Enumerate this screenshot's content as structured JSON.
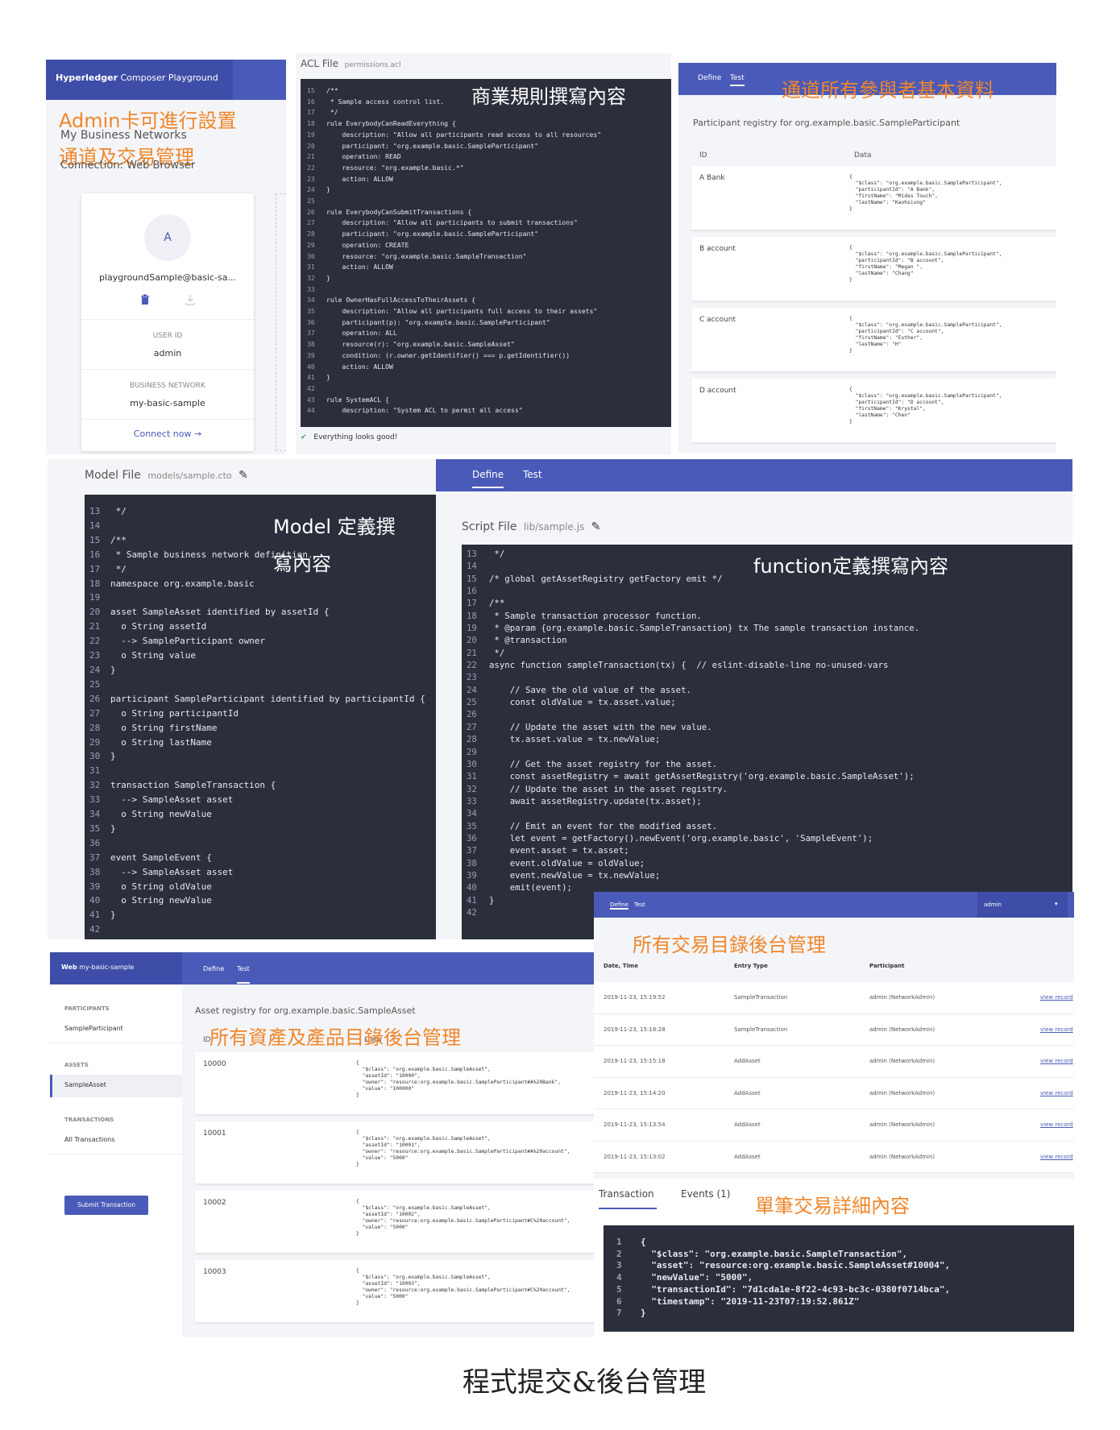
{
  "admin_panel": {
    "header": "Hyperledger Composer Playground",
    "header_bold": "Hyperledger",
    "header_rest": "Composer Playground",
    "networks_label": "My Business Networks",
    "connection_label": "Connection: Web Browser",
    "annotation_1": "Admin卡可進行設置",
    "annotation_2": "通道及交易管理",
    "card": {
      "avatar_letter": "A",
      "name": "playgroundSample@basic-sa...",
      "user_id_label": "USER ID",
      "user_id": "admin",
      "network_label": "BUSINESS NETWORK",
      "network": "my-basic-sample",
      "connect_label": "Connect now →"
    }
  },
  "acl_panel": {
    "title": "ACL File",
    "filename": "permissions.acl",
    "annotation": "商業規則撰寫內容",
    "status": "Everything looks good!",
    "lines": [
      {
        "n": "15",
        "t": "/**"
      },
      {
        "n": "16",
        "t": " * Sample access control list."
      },
      {
        "n": "17",
        "t": " */"
      },
      {
        "n": "18",
        "t": "rule EverybodyCanReadEverything {"
      },
      {
        "n": "19",
        "t": "    description: \"Allow all participants read access to all resources\""
      },
      {
        "n": "20",
        "t": "    participant: \"org.example.basic.SampleParticipant\""
      },
      {
        "n": "21",
        "t": "    operation: READ"
      },
      {
        "n": "22",
        "t": "    resource: \"org.example.basic.*\""
      },
      {
        "n": "23",
        "t": "    action: ALLOW"
      },
      {
        "n": "24",
        "t": "}"
      },
      {
        "n": "25",
        "t": ""
      },
      {
        "n": "26",
        "t": "rule EverybodyCanSubmitTransactions {"
      },
      {
        "n": "27",
        "t": "    description: \"Allow all participants to submit transactions\""
      },
      {
        "n": "28",
        "t": "    participant: \"org.example.basic.SampleParticipant\""
      },
      {
        "n": "29",
        "t": "    operation: CREATE"
      },
      {
        "n": "30",
        "t": "    resource: \"org.example.basic.SampleTransaction\""
      },
      {
        "n": "31",
        "t": "    action: ALLOW"
      },
      {
        "n": "32",
        "t": "}"
      },
      {
        "n": "33",
        "t": ""
      },
      {
        "n": "34",
        "t": "rule OwnerHasFullAccessToTheirAssets {"
      },
      {
        "n": "35",
        "t": "    description: \"Allow all participants full access to their assets\""
      },
      {
        "n": "36",
        "t": "    participant(p): \"org.example.basic.SampleParticipant\""
      },
      {
        "n": "37",
        "t": "    operation: ALL"
      },
      {
        "n": "38",
        "t": "    resource(r): \"org.example.basic.SampleAsset\""
      },
      {
        "n": "39",
        "t": "    condition: (r.owner.getIdentifier() === p.getIdentifier())"
      },
      {
        "n": "40",
        "t": "    action: ALLOW"
      },
      {
        "n": "41",
        "t": "}"
      },
      {
        "n": "42",
        "t": ""
      },
      {
        "n": "43",
        "t": "rule SystemACL {"
      },
      {
        "n": "44",
        "t": "    description: \"System ACL to permit all access\""
      }
    ]
  },
  "participant_panel": {
    "tabs": [
      "Define",
      "Test"
    ],
    "annotation": "通道所有參與者基本資料",
    "registry_title": "Participant registry for org.example.basic.SampleParticipant",
    "col_id": "ID",
    "col_data": "Data",
    "records": [
      {
        "id": "A Bank",
        "data": "{\n  \"$class\": \"org.example.basic.SampleParticipant\",\n  \"participantId\": \"A Bank\",\n  \"firstName\": \"Midas Touch\",\n  \"lastName\": \"Kaohsiung\"\n}"
      },
      {
        "id": "B account",
        "data": "{\n  \"$class\": \"org.example.basic.SampleParticipant\",\n  \"participantId\": \"B account\",\n  \"firstName\": \"Megan \",\n  \"lastName\": \"Chang\"\n}"
      },
      {
        "id": "C account",
        "data": "{\n  \"$class\": \"org.example.basic.SampleParticipant\",\n  \"participantId\": \"C account\",\n  \"firstName\": \"Esther\",\n  \"lastName\": \"H\"\n}"
      },
      {
        "id": "D account",
        "data": "{\n  \"$class\": \"org.example.basic.SampleParticipant\",\n  \"participantId\": \"D account\",\n  \"firstName\": \"Krystal\",\n  \"lastName\": \"Chen\"\n}"
      }
    ]
  },
  "model_panel": {
    "title": "Model File",
    "filename": "models/sample.cto",
    "annotation_1": "Model 定義撰",
    "annotation_2": "寫內容",
    "lines": [
      {
        "n": "13",
        "t": " */"
      },
      {
        "n": "14",
        "t": ""
      },
      {
        "n": "15",
        "t": "/**"
      },
      {
        "n": "16",
        "t": " * Sample business network definition."
      },
      {
        "n": "17",
        "t": " */"
      },
      {
        "n": "18",
        "t": "namespace org.example.basic"
      },
      {
        "n": "19",
        "t": ""
      },
      {
        "n": "20",
        "t": "asset SampleAsset identified by assetId {"
      },
      {
        "n": "21",
        "t": "  o String assetId"
      },
      {
        "n": "22",
        "t": "  --> SampleParticipant owner"
      },
      {
        "n": "23",
        "t": "  o String value"
      },
      {
        "n": "24",
        "t": "}"
      },
      {
        "n": "25",
        "t": ""
      },
      {
        "n": "26",
        "t": "participant SampleParticipant identified by participantId {"
      },
      {
        "n": "27",
        "t": "  o String participantId"
      },
      {
        "n": "28",
        "t": "  o String firstName"
      },
      {
        "n": "29",
        "t": "  o String lastName"
      },
      {
        "n": "30",
        "t": "}"
      },
      {
        "n": "31",
        "t": ""
      },
      {
        "n": "32",
        "t": "transaction SampleTransaction {"
      },
      {
        "n": "33",
        "t": "  --> SampleAsset asset"
      },
      {
        "n": "34",
        "t": "  o String newValue"
      },
      {
        "n": "35",
        "t": "}"
      },
      {
        "n": "36",
        "t": ""
      },
      {
        "n": "37",
        "t": "event SampleEvent {"
      },
      {
        "n": "38",
        "t": "  --> SampleAsset asset"
      },
      {
        "n": "39",
        "t": "  o String oldValue"
      },
      {
        "n": "40",
        "t": "  o String newValue"
      },
      {
        "n": "41",
        "t": "}"
      },
      {
        "n": "42",
        "t": ""
      }
    ]
  },
  "script_panel": {
    "tabs": [
      "Define",
      "Test"
    ],
    "title": "Script File",
    "filename": "lib/sample.js",
    "annotation": "function定義撰寫內容",
    "lines": [
      {
        "n": "13",
        "t": " */"
      },
      {
        "n": "14",
        "t": ""
      },
      {
        "n": "15",
        "t": "/* global getAssetRegistry getFactory emit */"
      },
      {
        "n": "16",
        "t": ""
      },
      {
        "n": "17",
        "t": "/**"
      },
      {
        "n": "18",
        "t": " * Sample transaction processor function."
      },
      {
        "n": "19",
        "t": " * @param {org.example.basic.SampleTransaction} tx The sample transaction instance."
      },
      {
        "n": "20",
        "t": " * @transaction"
      },
      {
        "n": "21",
        "t": " */"
      },
      {
        "n": "22",
        "t": "async function sampleTransaction(tx) {  // eslint-disable-line no-unused-vars"
      },
      {
        "n": "23",
        "t": ""
      },
      {
        "n": "24",
        "t": "    // Save the old value of the asset."
      },
      {
        "n": "25",
        "t": "    const oldValue = tx.asset.value;"
      },
      {
        "n": "26",
        "t": ""
      },
      {
        "n": "27",
        "t": "    // Update the asset with the new value."
      },
      {
        "n": "28",
        "t": "    tx.asset.value = tx.newValue;"
      },
      {
        "n": "29",
        "t": ""
      },
      {
        "n": "30",
        "t": "    // Get the asset registry for the asset."
      },
      {
        "n": "31",
        "t": "    const assetRegistry = await getAssetRegistry('org.example.basic.SampleAsset');"
      },
      {
        "n": "32",
        "t": "    // Update the asset in the asset registry."
      },
      {
        "n": "33",
        "t": "    await assetRegistry.update(tx.asset);"
      },
      {
        "n": "34",
        "t": ""
      },
      {
        "n": "35",
        "t": "    // Emit an event for the modified asset."
      },
      {
        "n": "36",
        "t": "    let event = getFactory().newEvent('org.example.basic', 'SampleEvent');"
      },
      {
        "n": "37",
        "t": "    event.asset = tx.asset;"
      },
      {
        "n": "38",
        "t": "    event.oldValue = oldValue;"
      },
      {
        "n": "39",
        "t": "    event.newValue = tx.newValue;"
      },
      {
        "n": "40",
        "t": "    emit(event);"
      },
      {
        "n": "41",
        "t": "}"
      },
      {
        "n": "42",
        "t": ""
      }
    ]
  },
  "asset_panel": {
    "brand_bold": "Web",
    "brand_rest": "my-basic-sample",
    "tabs": [
      "Define",
      "Test"
    ],
    "annotation": "所有資產及產品目錄後台管理",
    "sidebar": {
      "participants_heading": "PARTICIPANTS",
      "participant_item": "SampleParticipant",
      "assets_heading": "ASSETS",
      "asset_item": "SampleAsset",
      "transactions_heading": "TRANSACTIONS",
      "transaction_item": "All Transactions",
      "submit_button": "Submit Transaction"
    },
    "registry_title": "Asset registry for org.example.basic.SampleAsset",
    "col_id": "ID",
    "col_data": "Data",
    "records": [
      {
        "id": "10000",
        "data": "{\n  \"$class\": \"org.example.basic.SampleAsset\",\n  \"assetId\": \"10000\",\n  \"owner\": \"resource:org.example.basic.SampleParticipant#A%20Bank\",\n  \"value\": \"100000\"\n}"
      },
      {
        "id": "10001",
        "data": "{\n  \"$class\": \"org.example.basic.SampleAsset\",\n  \"assetId\": \"10001\",\n  \"owner\": \"resource:org.example.basic.SampleParticipant#A%20account\",\n  \"value\": \"5000\"\n}"
      },
      {
        "id": "10002",
        "data": "{\n  \"$class\": \"org.example.basic.SampleAsset\",\n  \"assetId\": \"10002\",\n  \"owner\": \"resource:org.example.basic.SampleParticipant#C%20account\",\n  \"value\": \"5000\"\n}"
      },
      {
        "id": "10003",
        "data": "{\n  \"$class\": \"org.example.basic.SampleAsset\",\n  \"assetId\": \"10003\",\n  \"owner\": \"resource:org.example.basic.SampleParticipant#C%20account\",\n  \"value\": \"5000\"\n}"
      }
    ]
  },
  "tx_panel": {
    "tabs": [
      "Define",
      "Test"
    ],
    "user": "admin",
    "annotation": "所有交易目錄後台管理",
    "col_date": "Date, Time",
    "col_type": "Entry Type",
    "col_participant": "Participant",
    "rows": [
      {
        "date": "2019-11-23, 15:19:52",
        "type": "SampleTransaction",
        "participant": "admin (NetworkAdmin)",
        "link": "view record"
      },
      {
        "date": "2019-11-23, 15:18:28",
        "type": "SampleTransaction",
        "participant": "admin (NetworkAdmin)",
        "link": "view record"
      },
      {
        "date": "2019-11-23, 15:15:18",
        "type": "AddAsset",
        "participant": "admin (NetworkAdmin)",
        "link": "view record"
      },
      {
        "date": "2019-11-23, 15:14:20",
        "type": "AddAsset",
        "participant": "admin (NetworkAdmin)",
        "link": "view record"
      },
      {
        "date": "2019-11-23, 15:13:54",
        "type": "AddAsset",
        "participant": "admin (NetworkAdmin)",
        "link": "view record"
      },
      {
        "date": "2019-11-23, 15:13:02",
        "type": "AddAsset",
        "participant": "admin (NetworkAdmin)",
        "link": "view record"
      }
    ]
  },
  "detail_panel": {
    "tab_transaction": "Transaction",
    "tab_events": "Events (1)",
    "annotation": "單筆交易詳細內容",
    "lines": [
      {
        "n": "1",
        "t": "{"
      },
      {
        "n": "2",
        "t": "  \"$class\": \"org.example.basic.SampleTransaction\","
      },
      {
        "n": "3",
        "t": "  \"asset\": \"resource:org.example.basic.SampleAsset#10004\","
      },
      {
        "n": "4",
        "t": "  \"newValue\": \"5000\","
      },
      {
        "n": "5",
        "t": "  \"transactionId\": \"7d1cda1e-8f22-4c93-bc3c-0380f0714bca\","
      },
      {
        "n": "6",
        "t": "  \"timestamp\": \"2019-11-23T07:19:52.861Z\""
      },
      {
        "n": "7",
        "t": "}"
      }
    ]
  },
  "caption": "程式提交&後台管理",
  "colors": {
    "accent": "#4a5ab8",
    "annotation": "#f0862a",
    "code_bg": "#2b2e3b"
  }
}
